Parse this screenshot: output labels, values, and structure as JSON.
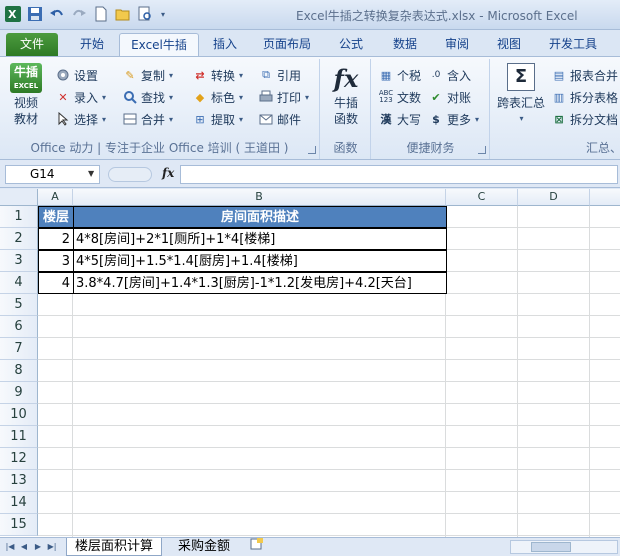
{
  "window": {
    "title": "Excel牛插之转换复杂表达式.xlsx  -  Microsoft Excel",
    "app_icon": "X",
    "qat": [
      "save-icon",
      "undo-icon",
      "redo-icon",
      "new-icon",
      "open-icon",
      "preview-icon"
    ]
  },
  "tabs": [
    "文件",
    "开始",
    "Excel牛插",
    "插入",
    "页面布局",
    "公式",
    "数据",
    "审阅",
    "视图",
    "开发工具"
  ],
  "active_tab": "Excel牛插",
  "ribbon": {
    "logo_top": "牛插",
    "logo_bottom": "EXCEL",
    "video_label": "视频\n教材",
    "col1": [
      "设置",
      "录入",
      "选择"
    ],
    "col2": [
      "复制",
      "查找",
      "合并"
    ],
    "col3": [
      "转换",
      "标色",
      "提取"
    ],
    "col4": [
      "引用",
      "打印",
      "邮件"
    ],
    "group1_label": "Office 动力 | 专注于企业 Office 培训 ( 王道田 )",
    "func_label": "牛插\n函数",
    "func_group_label": "函数",
    "fx_symbol": "fx",
    "col5": [
      "个税",
      "文数",
      "大写"
    ],
    "col6": [
      "含入",
      "对账",
      "更多"
    ],
    "finance_group_label": "便捷财务",
    "sum_label": "跨表汇总",
    "col7": [
      "报表合并",
      "拆分表格",
      "拆分文档"
    ],
    "sum_group_label": "汇总、"
  },
  "formula_bar": {
    "name_box": "G14",
    "fx": "fx",
    "value": ""
  },
  "columns": [
    "A",
    "B",
    "C",
    "D"
  ],
  "rows": [
    "1",
    "2",
    "3",
    "4",
    "5",
    "6",
    "7",
    "8",
    "9",
    "10",
    "11",
    "12",
    "13",
    "14",
    "15"
  ],
  "table": {
    "headers": [
      "楼层",
      "房间面积描述"
    ],
    "data": [
      {
        "floor": "2",
        "desc": "4*8[房间]+2*1[厕所]+1*4[楼梯]"
      },
      {
        "floor": "3",
        "desc": "4*5[房间]+1.5*1.4[厨房]+1.4[楼梯]"
      },
      {
        "floor": "4",
        "desc": "3.8*4.7[房间]+1.4*1.3[厨房]-1*1.2[发电房]+4.2[天台]"
      }
    ]
  },
  "sheets": [
    "楼层面积计算",
    "采购金额"
  ],
  "active_sheet": "楼层面积计算",
  "colors": {
    "header_fill": "#4f81bd",
    "file_tab": "#2e7a25"
  }
}
